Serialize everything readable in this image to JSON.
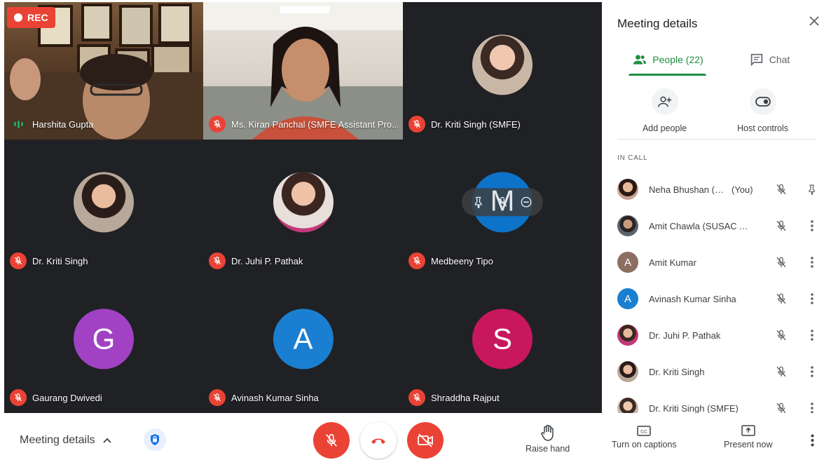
{
  "recording": {
    "label": "REC"
  },
  "tiles": [
    {
      "name": "Harshita Gupta",
      "state": "speaking"
    },
    {
      "name": "Ms. Kiran Panchal (SMFE Assistant Pro...",
      "state": "muted"
    },
    {
      "name": "Dr. Kriti Singh (SMFE)",
      "state": "muted"
    },
    {
      "name": "Dr. Kriti Singh",
      "state": "muted"
    },
    {
      "name": "Dr. Juhi P. Pathak",
      "state": "muted"
    },
    {
      "name": "Medbeeny Tipo",
      "state": "muted",
      "initial": "M",
      "color": "#0d73c9"
    },
    {
      "name": "Gaurang Dwivedi",
      "state": "muted",
      "initial": "G",
      "color": "#a142c4"
    },
    {
      "name": "Avinash Kumar Sinha",
      "state": "muted",
      "initial": "A",
      "color": "#1a7fd0"
    },
    {
      "name": "Shraddha Rajput",
      "state": "muted",
      "initial": "S",
      "color": "#c8175d"
    }
  ],
  "panel": {
    "title": "Meeting details",
    "tabs": {
      "people": "People (22)",
      "chat": "Chat"
    },
    "actions": {
      "add_people": "Add people",
      "host_controls": "Host controls"
    },
    "section": "IN CALL",
    "participants": [
      {
        "name": "Neha Bhushan (S...",
        "you": "(You)",
        "avatar": "photo"
      },
      {
        "name": "Amit Chawla (SUSAC As...",
        "avatar": "photo"
      },
      {
        "name": "Amit Kumar",
        "initial": "A",
        "color": "#8d6e63"
      },
      {
        "name": "Avinash Kumar Sinha",
        "initial": "A",
        "color": "#1a7fd0"
      },
      {
        "name": "Dr. Juhi P. Pathak",
        "avatar": "photo"
      },
      {
        "name": "Dr. Kriti Singh",
        "avatar": "photo"
      },
      {
        "name": "Dr. Kriti Singh (SMFE)",
        "avatar": "photo"
      }
    ]
  },
  "bottom": {
    "meeting_details": "Meeting details",
    "raise_hand": "Raise hand",
    "captions": "Turn on captions",
    "present": "Present now"
  },
  "colors": {
    "accent_green": "#1e8e3e",
    "danger_red": "#ea4335",
    "grid_bg": "#202124"
  }
}
